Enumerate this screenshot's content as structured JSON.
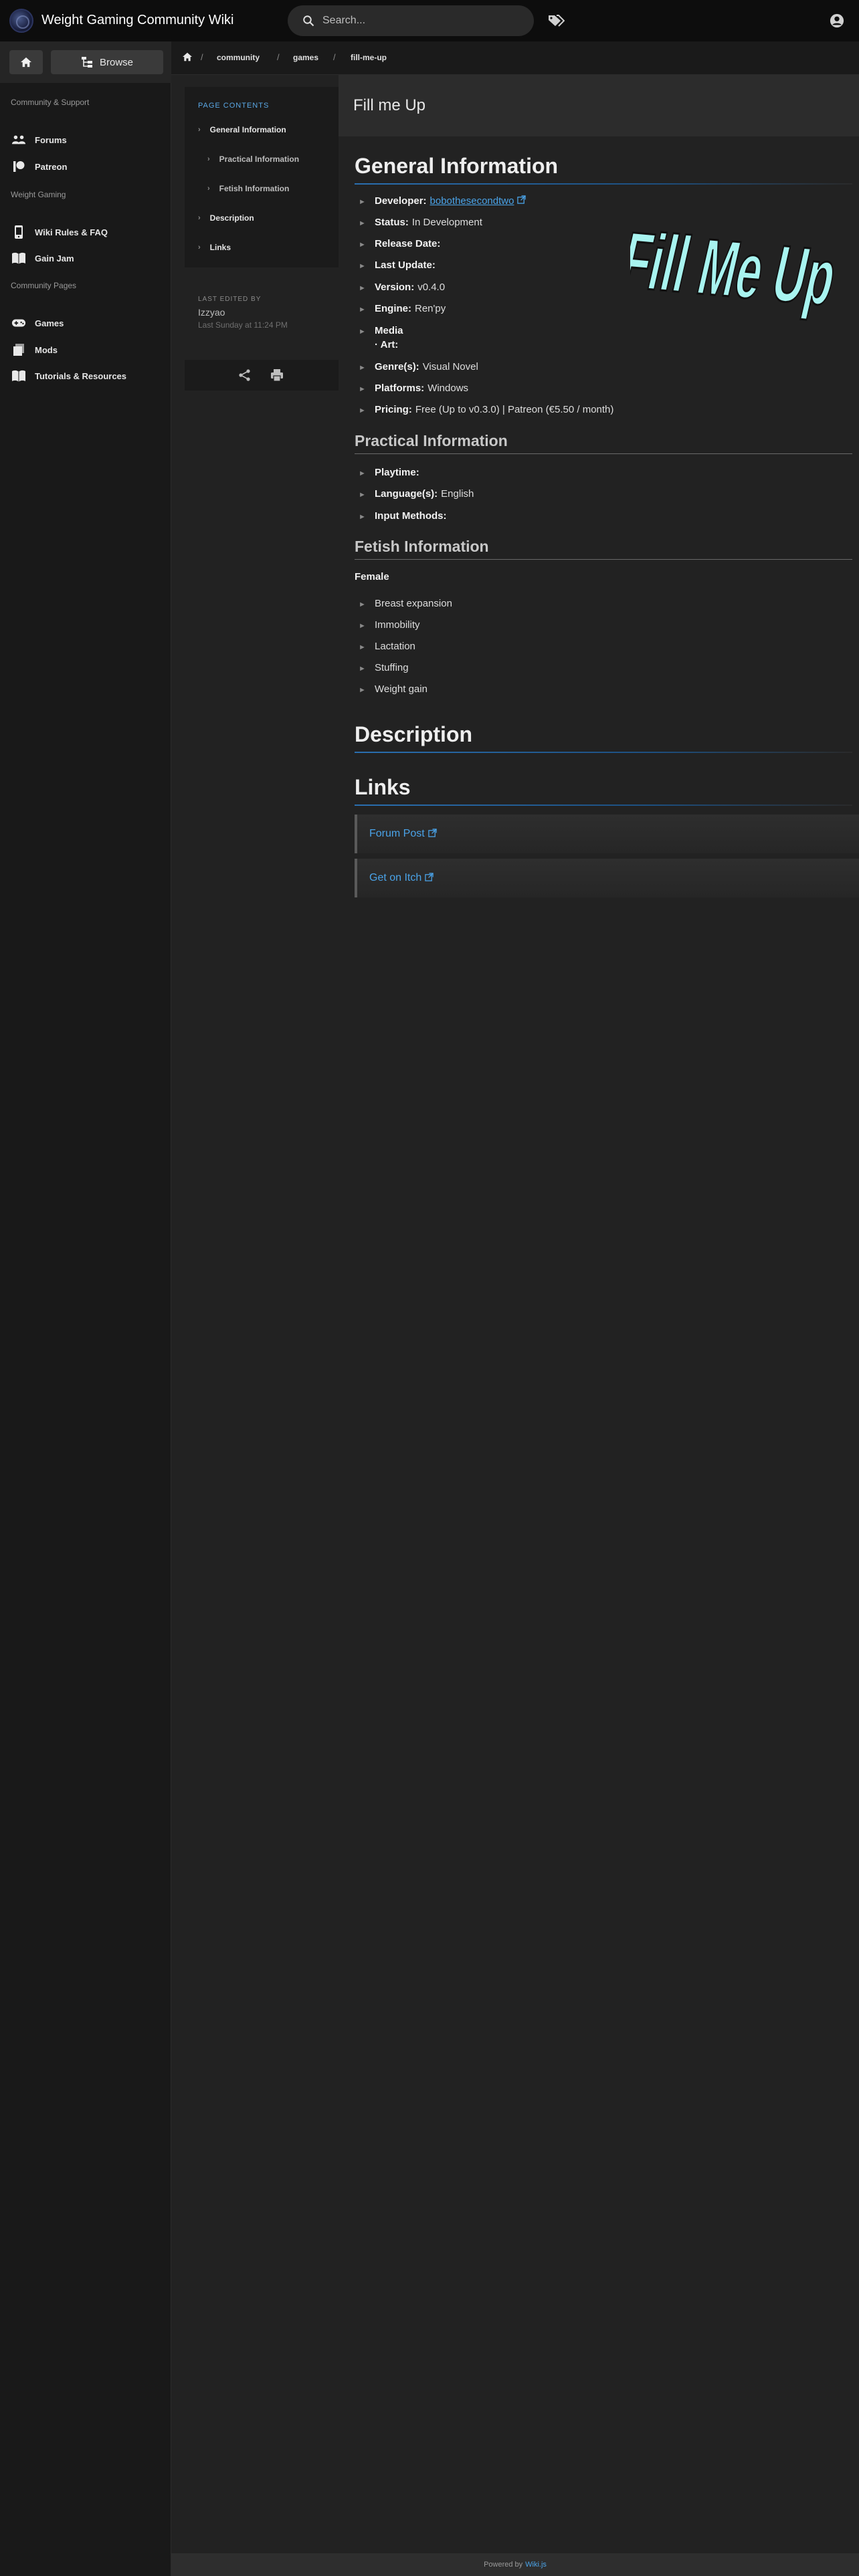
{
  "header": {
    "site_title": "Weight Gaming Community Wiki",
    "search_placeholder": "Search..."
  },
  "nav": {
    "browse_label": "Browse",
    "sections": [
      {
        "header": "Community & Support",
        "items": [
          {
            "label": "Forums",
            "icon": "people-icon"
          },
          {
            "label": "Patreon",
            "icon": "patreon-icon"
          }
        ]
      },
      {
        "header": "Weight Gaming",
        "items": [
          {
            "label": "Wiki Rules & FAQ",
            "icon": "phone-icon"
          },
          {
            "label": "Gain Jam",
            "icon": "book-icon"
          }
        ]
      },
      {
        "header": "Community Pages",
        "items": [
          {
            "label": "Games",
            "icon": "gamepad-icon"
          },
          {
            "label": "Mods",
            "icon": "layers-icon"
          },
          {
            "label": "Tutorials & Resources",
            "icon": "book-icon"
          }
        ]
      }
    ]
  },
  "breadcrumb": [
    "community",
    "games",
    "fill-me-up"
  ],
  "toc": {
    "title": "PAGE CONTENTS",
    "items": [
      "General Information",
      "Practical Information",
      "Fetish Information",
      "Description",
      "Links"
    ]
  },
  "last_edited": {
    "label": "LAST EDITED BY",
    "user": "Izzyao",
    "date": "Last Sunday at 11:24 PM"
  },
  "page": {
    "title": "Fill me Up",
    "logo_text": "Fill Me Up",
    "general": {
      "heading": "General Information",
      "developer_label": "Developer:",
      "developer_value": "bobothesecondtwo",
      "status_label": "Status:",
      "status_value": "In Development",
      "release_label": "Release Date:",
      "update_label": "Last Update:",
      "version_label": "Version:",
      "version_value": "v0.4.0",
      "engine_label": "Engine:",
      "engine_value": "Ren'py",
      "media_label": "Media",
      "art_label": "· Art:",
      "genre_label": "Genre(s):",
      "genre_value": "Visual Novel",
      "platforms_label": "Platforms:",
      "platforms_value": "Windows",
      "pricing_label": "Pricing:",
      "pricing_value": "Free (Up to v0.3.0) | Patreon (€5.50 / month)"
    },
    "practical": {
      "heading": "Practical Information",
      "playtime_label": "Playtime:",
      "language_label": "Language(s):",
      "language_value": "English",
      "input_label": "Input Methods:"
    },
    "fetish": {
      "heading": "Fetish Information",
      "group": "Female",
      "items": [
        "Breast expansion",
        "Immobility",
        "Lactation",
        "Stuffing",
        "Weight gain"
      ]
    },
    "description_heading": "Description",
    "links_heading": "Links",
    "links": [
      "Forum Post",
      "Get on Itch"
    ]
  },
  "footer": {
    "powered_by": "Powered by",
    "wikijs": "Wiki.js"
  }
}
